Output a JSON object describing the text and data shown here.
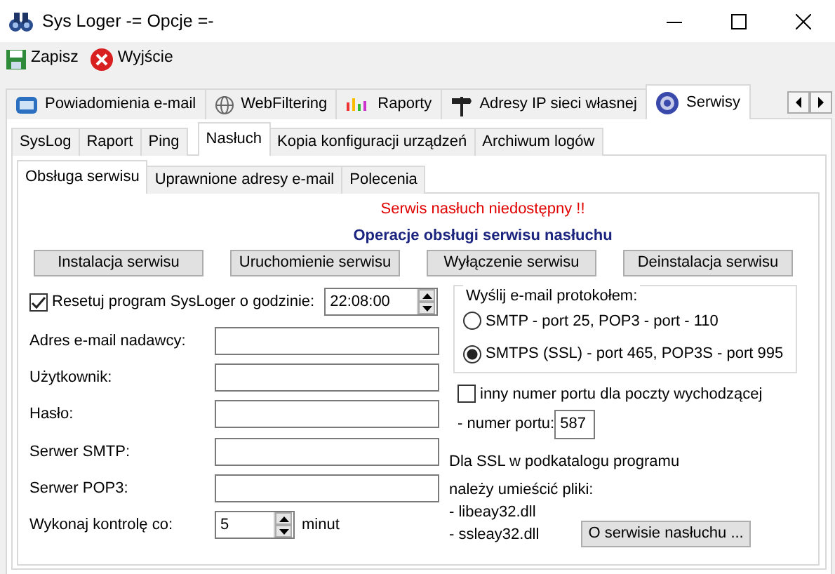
{
  "window": {
    "title": "Sys Loger -= Opcje =-"
  },
  "toolbar": [
    {
      "label": "Zapisz",
      "kind": "save"
    },
    {
      "label": "Wyjście",
      "kind": "exit"
    }
  ],
  "main_tabs": [
    {
      "label": "Powiadomienia e-mail",
      "selected": false,
      "kind": "mail"
    },
    {
      "label": "WebFiltering",
      "selected": false,
      "kind": "globe"
    },
    {
      "label": "Raporty",
      "selected": false,
      "kind": "chart"
    },
    {
      "label": "Adresy IP sieci własnej",
      "selected": false,
      "kind": "sign"
    },
    {
      "label": "Serwisy",
      "selected": true,
      "kind": "service"
    }
  ],
  "sub_tabs": [
    {
      "label": "SysLog",
      "selected": false
    },
    {
      "label": "Raport",
      "selected": false
    },
    {
      "label": "Ping",
      "selected": false
    },
    {
      "label": "Nasłuch",
      "selected": true
    },
    {
      "label": "Kopia konfiguracji urządzeń",
      "selected": false
    },
    {
      "label": "Archiwum logów",
      "selected": false
    }
  ],
  "inner_tabs": [
    {
      "label": "Obsługa serwisu",
      "selected": true
    },
    {
      "label": "Uprawnione adresy e-mail",
      "selected": false
    },
    {
      "label": "Polecenia",
      "selected": false
    }
  ],
  "status_message": "Serwis nasłuch niedostępny !!",
  "section_title": "Operacje obsługi serwisu nasłuchu",
  "service_buttons": [
    "Instalacja serwisu",
    "Uruchomienie serwisu",
    "Wyłączenie serwisu",
    "Deinstalacja serwisu"
  ],
  "reset": {
    "label": "Resetuj program SysLoger o godzinie:",
    "checked": true,
    "value": "22:08:00"
  },
  "fields": [
    {
      "label": "Adres e-mail nadawcy:"
    },
    {
      "label": "Użytkownik:"
    },
    {
      "label": "Hasło:"
    },
    {
      "label": "Serwer SMTP:"
    },
    {
      "label": "Serwer POP3:"
    }
  ],
  "check_interval": {
    "label": "Wykonaj kontrolę co:",
    "value": "5",
    "unit": "minut"
  },
  "protocol": {
    "legend": "Wyślij e-mail protokołem:",
    "options": [
      {
        "label": "SMTP - port 25, POP3 - port - 110",
        "selected": false
      },
      {
        "label": "SMTPS (SSL) - port 465, POP3S - port 995",
        "selected": true
      }
    ]
  },
  "custom_port": {
    "label": "inny numer portu dla poczty wychodzącej",
    "checked": false,
    "port_label": "- numer portu:",
    "port_value": "587"
  },
  "ssl_note": [
    "Dla SSL w podkatalogu programu",
    "należy umieścić pliki:",
    "- libeay32.dll",
    "- ssleay32.dll"
  ],
  "about_button": "O serwisie nasłuchu ..."
}
